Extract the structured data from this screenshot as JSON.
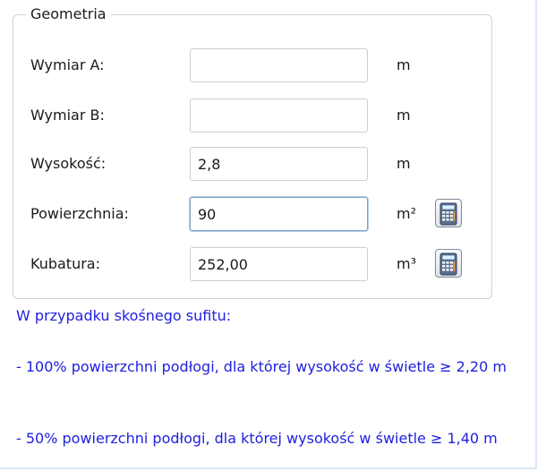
{
  "geometry": {
    "legend": "Geometria",
    "rows": [
      {
        "label": "Wymiar A:",
        "value": "",
        "unit": "m",
        "has_calc": false
      },
      {
        "label": "Wymiar B:",
        "value": "",
        "unit": "m",
        "has_calc": false
      },
      {
        "label": "Wysokość:",
        "value": "2,8",
        "unit": "m",
        "has_calc": false
      },
      {
        "label": "Powierzchnia:",
        "value": "90",
        "unit": "m²",
        "has_calc": true
      },
      {
        "label": "Kubatura:",
        "value": "252,00",
        "unit": "m³",
        "has_calc": true
      }
    ]
  },
  "notes": {
    "heading": "W przypadku skośnego sufitu:",
    "item1": "- 100% powierzchni podłogi, dla której wysokość w świetle ≥ 2,20 m",
    "item2": "- 50% powierzchni podłogi, dla której wysokość w świetle ≥ 1,40 m"
  },
  "icons": {
    "calculator": "calculator-icon"
  },
  "colors": {
    "note_text": "#2020e0",
    "frame_border": "#d9e6f4",
    "fieldset_border": "#c9d3de",
    "focused_border": "#7fa2c9"
  }
}
